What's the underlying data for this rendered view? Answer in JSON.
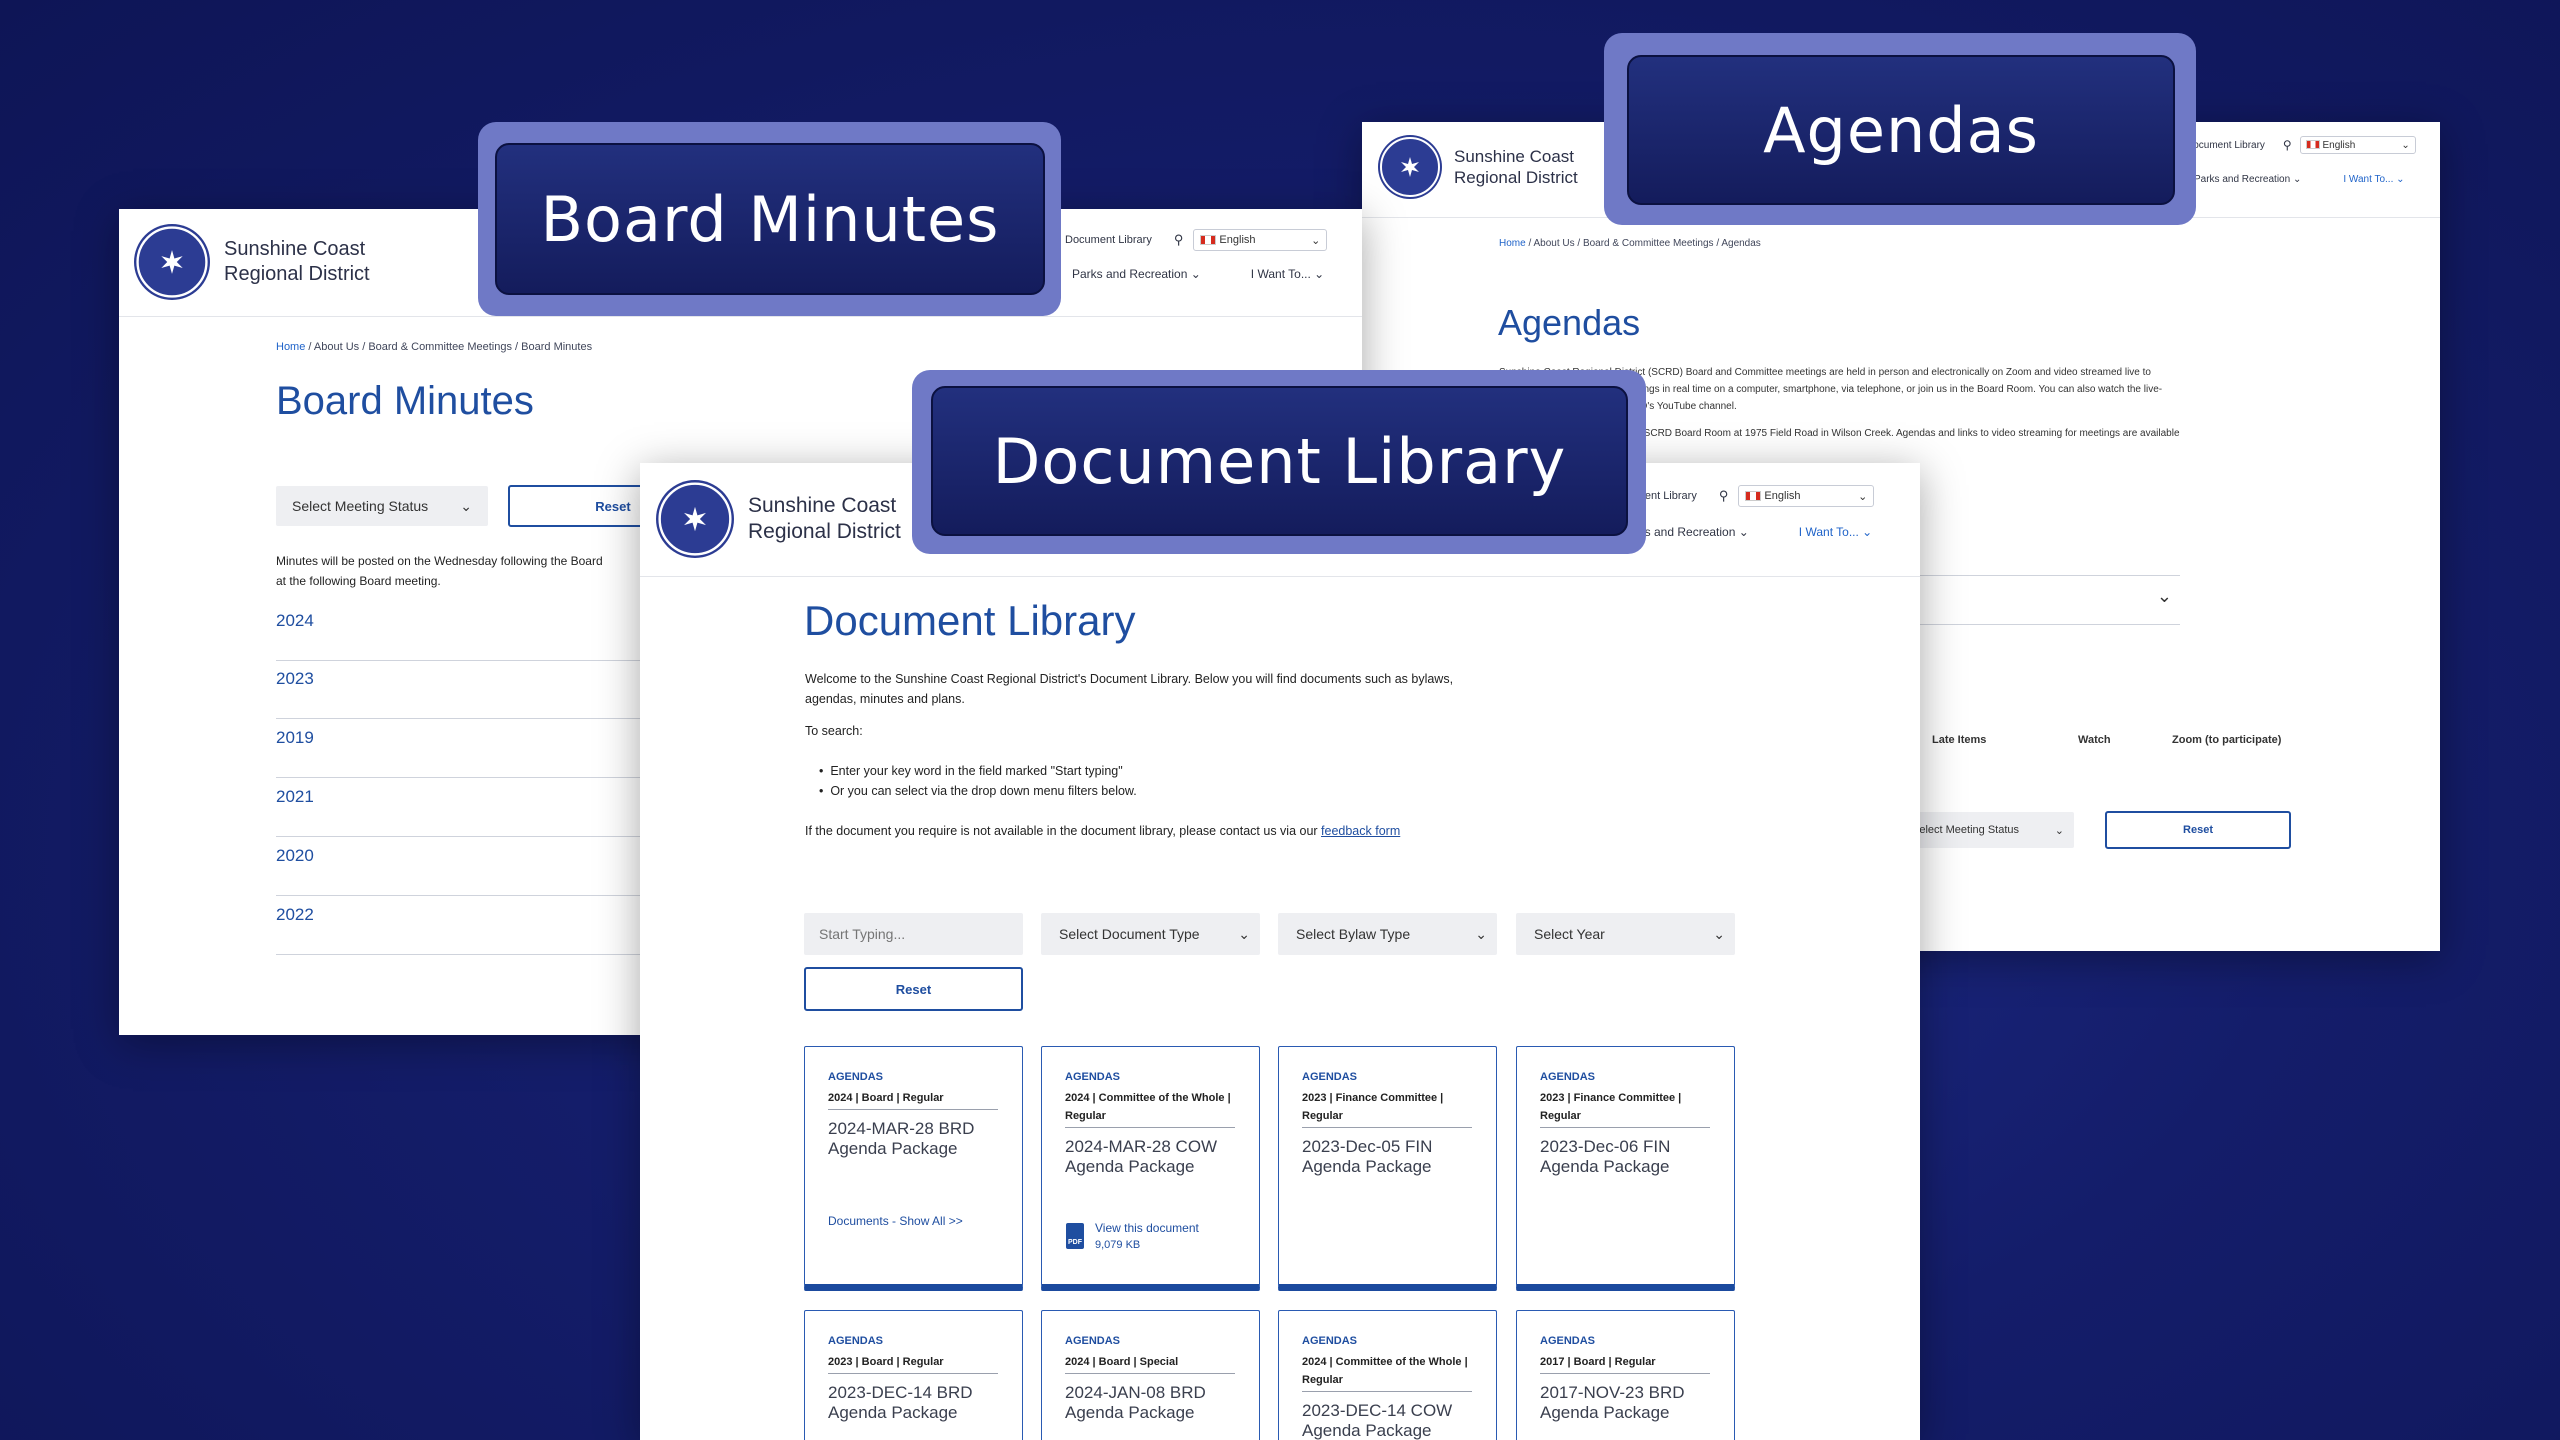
{
  "brand": {
    "line1": "Sunshine Coast",
    "line2": "Regional District",
    "logo_text": "SUNSHINE COAST REGIONAL DISTRICT"
  },
  "labels": {
    "board_minutes": "Board Minutes",
    "agendas": "Agendas",
    "document_library": "Document Library"
  },
  "topnav": {
    "document_library": "Document Library",
    "language": "English",
    "parks": "Parks and Recreation",
    "want": "I Want To..."
  },
  "board": {
    "breadcrumb": [
      "Home",
      " / About Us / Board & Committee Meetings / Board Minutes"
    ],
    "title": "Board Minutes",
    "select_status": "Select Meeting Status",
    "reset": "Reset",
    "note": "Minutes will be posted on the Wednesday following the Board",
    "note2": "at the following Board meeting.",
    "years": [
      "2024",
      "2023",
      "2019",
      "2021",
      "2020",
      "2022"
    ]
  },
  "agendas": {
    "breadcrumb": [
      "Home",
      " / About Us / Board & Committee Meetings / Agendas"
    ],
    "title": "Agendas",
    "p1a": "Sunshine Coast Regional District (SCRD) Board and Committee meetings are held in person and electronically on Zoom and video streamed live to",
    "p1b": "meetings in real time on a computer, smartphone, via telephone, or join us in the Board Room. You can also watch the live-",
    "p1c": "SCRD's YouTube channel.",
    "p2": "the SCRD Board Room at 1975 Field Road in Wilson Creek. Agendas and links to video streaming for meetings are available",
    "col_late": "Late Items",
    "col_watch": "Watch",
    "col_zoom": "Zoom (to participate)",
    "select_status": "Select Meeting Status",
    "reset": "Reset"
  },
  "doclib": {
    "title": "Document Library",
    "intro1": "Welcome to the Sunshine Coast Regional District's Document Library. Below you will find documents such as bylaws,",
    "intro2": "agendas, minutes and plans.",
    "to_search": "To search:",
    "bullet1": "Enter your key word in the field marked \"Start typing\"",
    "bullet2": "Or you can select via the drop down menu filters below.",
    "contact": "If the document you require is not available in the document library, please contact us via our ",
    "feedback": "feedback form",
    "search_placeholder": "Start Typing...",
    "filter_type": "Select Document Type",
    "filter_bylaw": "Select Bylaw Type",
    "filter_year": "Select Year",
    "reset": "Reset",
    "cards": [
      {
        "cat": "AGENDAS",
        "sub": "2024 | Board | Regular",
        "title": "2024-MAR-28 BRD Agenda Package",
        "link": "Documents - Show All >>"
      },
      {
        "cat": "AGENDAS",
        "sub": "2024 | Committee of the Whole | Regular",
        "title": "2024-MAR-28 COW Agenda Package",
        "view": "View this document",
        "size": "9,079 KB",
        "file_icon": "PDF"
      },
      {
        "cat": "AGENDAS",
        "sub": "2023 | Finance Committee | Regular",
        "title": "2023-Dec-05 FIN Agenda Package"
      },
      {
        "cat": "AGENDAS",
        "sub": "2023 | Finance Committee | Regular",
        "title": "2023-Dec-06 FIN Agenda Package"
      },
      {
        "cat": "AGENDAS",
        "sub": "2023 | Board | Regular",
        "title": "2023-DEC-14 BRD Agenda Package"
      },
      {
        "cat": "AGENDAS",
        "sub": "2024 | Board | Special",
        "title": "2024-JAN-08 BRD Agenda Package"
      },
      {
        "cat": "AGENDAS",
        "sub": "2024 | Committee of the Whole | Regular",
        "title": "2023-DEC-14 COW Agenda Package"
      },
      {
        "cat": "AGENDAS",
        "sub": "2017 | Board | Regular",
        "title": "2017-NOV-23 BRD Agenda Package"
      }
    ]
  },
  "colors": {
    "accent": "#1f4ea0",
    "link": "#1f63c9",
    "label_bg": "#1b2670",
    "label_border": "#6f79c6"
  }
}
